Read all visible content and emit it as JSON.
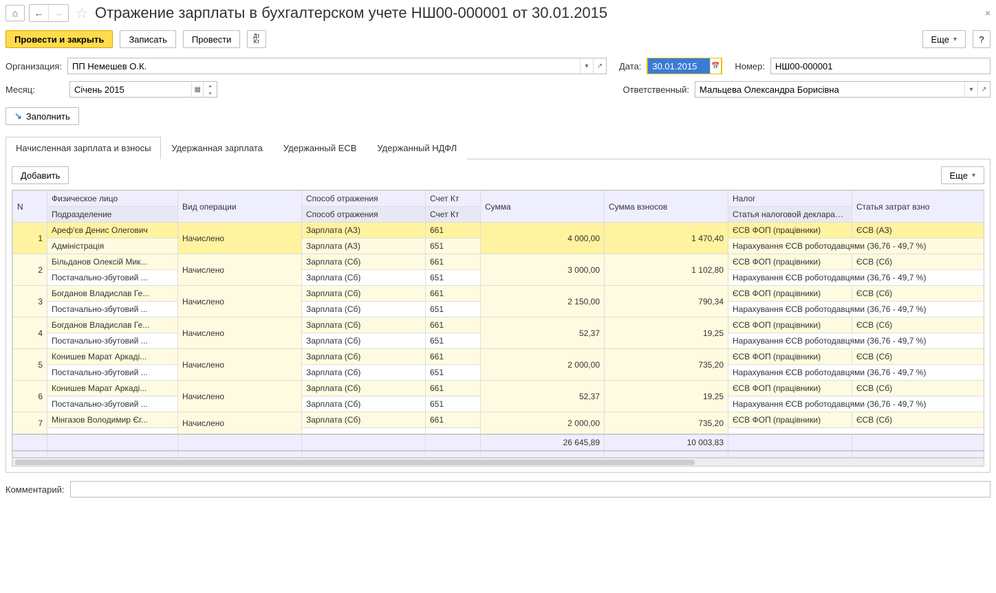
{
  "header": {
    "title": "Отражение зарплаты в бухгалтерском учете НШ00-000001 от 30.01.2015"
  },
  "cmd": {
    "post_close": "Провести и закрыть",
    "save": "Записать",
    "post": "Провести",
    "dtkt": "Дт\nКт",
    "more": "Еще",
    "help": "?"
  },
  "form": {
    "org_label": "Организация:",
    "org_value": "ПП Немешев О.К.",
    "date_label": "Дата:",
    "date_value": "30.01.2015",
    "number_label": "Номер:",
    "number_value": "НШ00-000001",
    "month_label": "Месяц:",
    "month_value": "Січень 2015",
    "resp_label": "Ответственный:",
    "resp_value": "Мальцева Олександра Борисівна",
    "fill": "Заполнить",
    "comment_label": "Комментарий:",
    "comment_value": ""
  },
  "tabs": {
    "t1": "Начисленная зарплата и взносы",
    "t2": "Удержанная зарплата",
    "t3": "Удержанный ЕСВ",
    "t4": "Удержанный НДФЛ"
  },
  "inner": {
    "add": "Добавить",
    "more": "Еще"
  },
  "cols": {
    "n": "N",
    "person": "Физическое лицо",
    "dept": "Подразделение",
    "op": "Вид операции",
    "way": "Способ отражения",
    "way2": "Способ отражения",
    "acc": "Счет Кт",
    "acc2": "Счет Кт",
    "sum": "Сумма",
    "sumv": "Сумма взносов",
    "tax": "Налог",
    "decl": "Статья налоговой декларации",
    "art": "Статья затрат взно"
  },
  "rows": [
    {
      "n": "1",
      "person": "Ареф'єв Денис Олегович",
      "dept": "Адміністрація",
      "op": "Начислено",
      "way": "Зарплата (АЗ)",
      "way2": "Зарплата (АЗ)",
      "acc": "661",
      "acc2": "651",
      "sum": "4 000,00",
      "sumv": "1 470,40",
      "tax": "ЄСВ ФОП (працівники)",
      "decl": "Нарахування ЄСВ роботодавцями (36,76 - 49,7 %)",
      "art": "ЄСВ (АЗ)"
    },
    {
      "n": "2",
      "person": "Більданов Олексій Мик...",
      "dept": "Постачально-збутовий ...",
      "op": "Начислено",
      "way": "Зарплата (Сб)",
      "way2": "Зарплата (Сб)",
      "acc": "661",
      "acc2": "651",
      "sum": "3 000,00",
      "sumv": "1 102,80",
      "tax": "ЄСВ ФОП (працівники)",
      "decl": "Нарахування ЄСВ роботодавцями (36,76 - 49,7 %)",
      "art": "ЄСВ (Сб)"
    },
    {
      "n": "3",
      "person": "Богданов Владислав Ге...",
      "dept": "Постачально-збутовий ...",
      "op": "Начислено",
      "way": "Зарплата (Сб)",
      "way2": "Зарплата (Сб)",
      "acc": "661",
      "acc2": "651",
      "sum": "2 150,00",
      "sumv": "790,34",
      "tax": "ЄСВ ФОП (працівники)",
      "decl": "Нарахування ЄСВ роботодавцями (36,76 - 49,7 %)",
      "art": "ЄСВ (Сб)"
    },
    {
      "n": "4",
      "person": "Богданов Владислав Ге...",
      "dept": "Постачально-збутовий ...",
      "op": "Начислено",
      "way": "Зарплата (Сб)",
      "way2": "Зарплата (Сб)",
      "acc": "661",
      "acc2": "651",
      "sum": "52,37",
      "sumv": "19,25",
      "tax": "ЄСВ ФОП (працівники)",
      "decl": "Нарахування ЄСВ роботодавцями (36,76 - 49,7 %)",
      "art": "ЄСВ (Сб)"
    },
    {
      "n": "5",
      "person": "Конишев Марат Аркаді...",
      "dept": "Постачально-збутовий ...",
      "op": "Начислено",
      "way": "Зарплата (Сб)",
      "way2": "Зарплата (Сб)",
      "acc": "661",
      "acc2": "651",
      "sum": "2 000,00",
      "sumv": "735,20",
      "tax": "ЄСВ ФОП (працівники)",
      "decl": "Нарахування ЄСВ роботодавцями (36,76 - 49,7 %)",
      "art": "ЄСВ (Сб)"
    },
    {
      "n": "6",
      "person": "Конишев Марат Аркаді...",
      "dept": "Постачально-збутовий ...",
      "op": "Начислено",
      "way": "Зарплата (Сб)",
      "way2": "Зарплата (Сб)",
      "acc": "661",
      "acc2": "651",
      "sum": "52,37",
      "sumv": "19,25",
      "tax": "ЄСВ ФОП (працівники)",
      "decl": "Нарахування ЄСВ роботодавцями (36,76 - 49,7 %)",
      "art": "ЄСВ (Сб)"
    },
    {
      "n": "7",
      "person": "Мінгазов Володимир Єг...",
      "dept": "",
      "op": "Начислено",
      "way": "Зарплата (Сб)",
      "way2": "",
      "acc": "661",
      "acc2": "",
      "sum": "2 000,00",
      "sumv": "735,20",
      "tax": "ЄСВ ФОП (працівники)",
      "decl": "",
      "art": "ЄСВ (Сб)"
    }
  ],
  "totals": {
    "sum": "26 645,89",
    "sumv": "10 003,83"
  }
}
